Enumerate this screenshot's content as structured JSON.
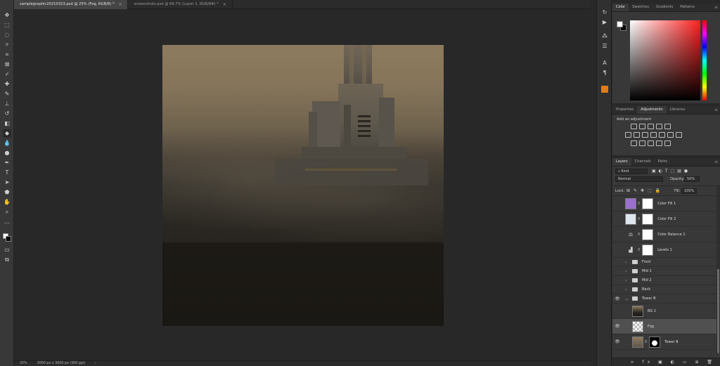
{
  "tabs": [
    {
      "label": "samplegraphic20210323.psd @ 25% (Fog, RGB/8) *",
      "active": true
    },
    {
      "label": "screenshots.psd @ 66.7% (Layer 1, RGB/8#) *",
      "active": false
    }
  ],
  "status": {
    "zoom": "25%",
    "doc_size": "3000 px x 3000 px (300 ppi)",
    "arrow": "›"
  },
  "color_panel": {
    "tabs": [
      "Color",
      "Swatches",
      "Gradients",
      "Patterns"
    ],
    "foreground": "#ffffff",
    "background": "#000000"
  },
  "adjustments_panel": {
    "tabs": [
      "Properties",
      "Adjustments",
      "Libraries"
    ],
    "title": "Add an adjustment"
  },
  "layers_panel": {
    "tabs": [
      "Layers",
      "Channels",
      "Paths"
    ],
    "filter_kind": "Kind",
    "blend_mode": "Normal",
    "opacity_label": "Opacity:",
    "opacity": "50%",
    "lock_label": "Lock:",
    "fill_label": "Fill:",
    "fill": "100%",
    "layers": [
      {
        "name": "Color Fill 1",
        "kind": "fill",
        "thumb_color": "#9b6fd0"
      },
      {
        "name": "Color Fill 2",
        "kind": "fill",
        "thumb_color": "#dfe6ee"
      },
      {
        "name": "Color Balance 1",
        "kind": "adjust",
        "icon": "⚖"
      },
      {
        "name": "Levels 1",
        "kind": "adjust",
        "icon": "▟"
      },
      {
        "name": "Front",
        "kind": "group"
      },
      {
        "name": "Mid 1",
        "kind": "group"
      },
      {
        "name": "Mid 2",
        "kind": "group"
      },
      {
        "name": "Back",
        "kind": "group"
      },
      {
        "name": "Tower B",
        "kind": "group-open"
      },
      {
        "name": "BG 1",
        "kind": "image"
      },
      {
        "name": "Fog",
        "kind": "image-transparent",
        "selected": true
      },
      {
        "name": "Tower B",
        "kind": "image-masked"
      }
    ]
  }
}
